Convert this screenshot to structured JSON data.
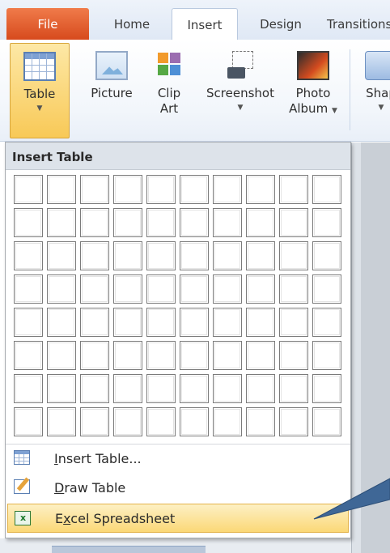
{
  "tabs": [
    {
      "label": "File"
    },
    {
      "label": "Home"
    },
    {
      "label": "Insert"
    },
    {
      "label": "Design"
    },
    {
      "label": "Transitions"
    }
  ],
  "ribbon": {
    "table": {
      "label": "Table",
      "icon": "table-icon"
    },
    "picture": {
      "label": "Picture",
      "icon": "picture-icon"
    },
    "clip_art": {
      "line1": "Clip",
      "line2": "Art",
      "icon": "clip-art-icon"
    },
    "screenshot": {
      "label": "Screenshot",
      "icon": "screenshot-icon"
    },
    "photo_album": {
      "line1": "Photo",
      "line2": "Album",
      "icon": "photo-album-icon"
    },
    "shapes": {
      "label": "Shap",
      "icon": "shapes-icon"
    }
  },
  "dropdown": {
    "header": "Insert Table",
    "grid_columns": 10,
    "grid_rows": 8,
    "items": [
      {
        "label_first": "I",
        "label_rest": "nsert Table...",
        "icon": "insert-table-icon"
      },
      {
        "label_first": "D",
        "label_rest": "raw Table",
        "icon": "draw-table-icon"
      },
      {
        "label_first": "E",
        "label_mid": "x",
        "label_rest": "cel Spreadsheet",
        "icon": "excel-spreadsheet-icon"
      }
    ]
  },
  "colors": {
    "file_tab": "#d6491c",
    "highlight": "#fbd877",
    "callout_arrow": "#3f6796"
  }
}
